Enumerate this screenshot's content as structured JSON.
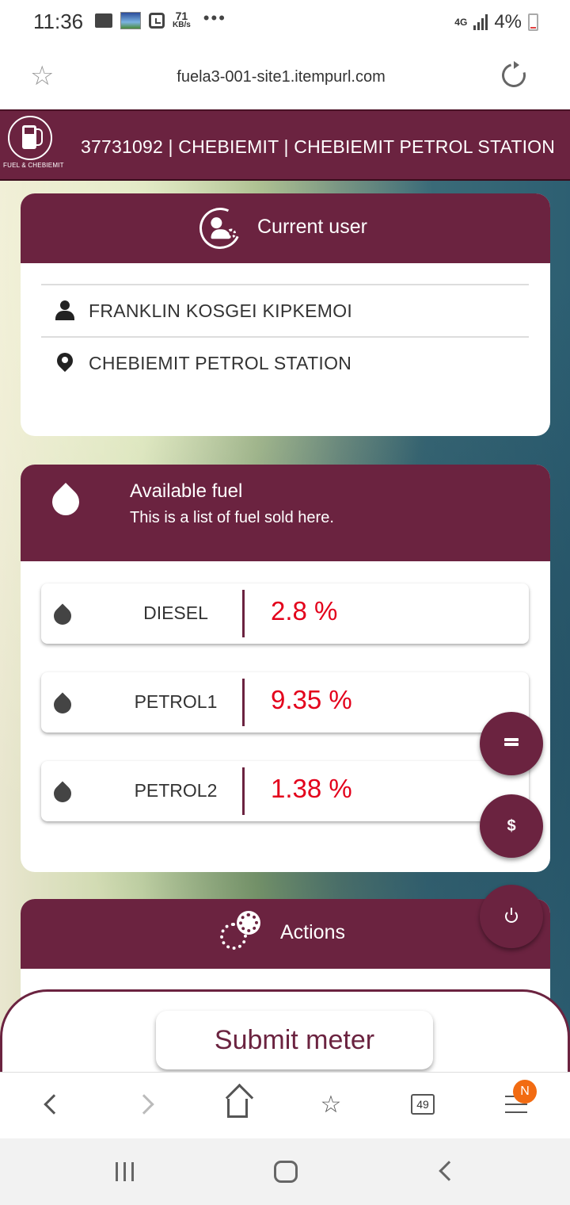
{
  "status_bar": {
    "time": "11:36",
    "speed_value": "71",
    "speed_unit": "KB/s",
    "more": "•••",
    "network": "4G",
    "battery": "4%"
  },
  "browser": {
    "url": "fuela3-001-site1.itempurl.com",
    "tabs_count": "49",
    "notification_badge": "N"
  },
  "header": {
    "logo_caption": "FUEL & CHEBIEMIT",
    "title": "37731092 | CHEBIEMIT | CHEBIEMIT PETROL STATION"
  },
  "current_user": {
    "title": "Current user",
    "name": "FRANKLIN KOSGEI KIPKEMOI",
    "station": "CHEBIEMIT PETROL STATION"
  },
  "available_fuel": {
    "title": "Available fuel",
    "subtitle": "This is a list of fuel sold here.",
    "items": [
      {
        "name": "DIESEL",
        "percent": "2.8 %"
      },
      {
        "name": "PETROL1",
        "percent": "9.35 %"
      },
      {
        "name": "PETROL2",
        "percent": "1.38 %"
      }
    ]
  },
  "actions": {
    "title": "Actions"
  },
  "fab": {
    "dollar": "$"
  },
  "submit": {
    "label": "Submit meter"
  },
  "colors": {
    "brand": "#6b2340",
    "percent": "#e3001b",
    "notification": "#f26b12"
  }
}
